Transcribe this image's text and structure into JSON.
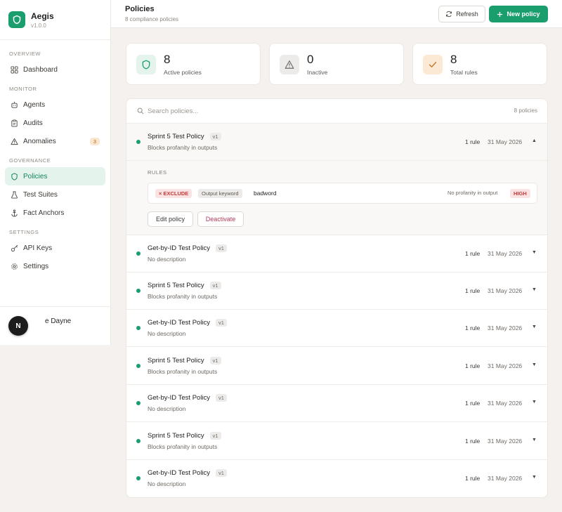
{
  "brand": {
    "name": "Aegis",
    "version": "v1.0.0"
  },
  "sidebar": {
    "sections": [
      {
        "label": "OVERVIEW",
        "items": [
          {
            "label": "Dashboard",
            "icon": "grid-icon"
          }
        ]
      },
      {
        "label": "MONITOR",
        "items": [
          {
            "label": "Agents",
            "icon": "robot-icon"
          },
          {
            "label": "Audits",
            "icon": "clipboard-icon"
          },
          {
            "label": "Anomalies",
            "icon": "warning-icon",
            "badge": "3"
          }
        ]
      },
      {
        "label": "GOVERNANCE",
        "items": [
          {
            "label": "Policies",
            "icon": "shield-icon",
            "active": true
          },
          {
            "label": "Test Suites",
            "icon": "flask-icon"
          },
          {
            "label": "Fact Anchors",
            "icon": "anchor-icon"
          }
        ]
      },
      {
        "label": "SETTINGS",
        "items": [
          {
            "label": "API Keys",
            "icon": "key-icon"
          },
          {
            "label": "Settings",
            "icon": "gear-icon"
          }
        ]
      }
    ],
    "user": {
      "initial": "N",
      "name": "e Dayne"
    }
  },
  "header": {
    "title": "Policies",
    "subtitle": "8 compliance policies",
    "refresh_label": "Refresh",
    "new_label": "New policy"
  },
  "stats": [
    {
      "value": "8",
      "label": "Active policies",
      "icon": "shield-icon",
      "bg": "#e4f4ec",
      "color": "#1a9e6e"
    },
    {
      "value": "0",
      "label": "Inactive",
      "icon": "warning-icon",
      "bg": "#ecebe9",
      "color": "#6f6a65"
    },
    {
      "value": "8",
      "label": "Total rules",
      "icon": "check-icon",
      "bg": "#fbe8d5",
      "color": "#c27a2c"
    }
  ],
  "search": {
    "placeholder": "Search policies...",
    "count": "8 policies"
  },
  "policies": [
    {
      "name": "Sprint 5 Test Policy",
      "version": "v1",
      "description": "Blocks profanity in outputs",
      "rules": "1 rule",
      "date": "31 May 2026",
      "chevron": "▲"
    },
    {
      "name": "Get-by-ID Test Policy",
      "version": "v1",
      "description": "No description",
      "rules": "1 rule",
      "date": "31 May 2026",
      "chevron": "▼"
    },
    {
      "name": "Sprint 5 Test Policy",
      "version": "v1",
      "description": "Blocks profanity in outputs",
      "rules": "1 rule",
      "date": "31 May 2026",
      "chevron": "▼"
    },
    {
      "name": "Get-by-ID Test Policy",
      "version": "v1",
      "description": "No description",
      "rules": "1 rule",
      "date": "31 May 2026",
      "chevron": "▼"
    },
    {
      "name": "Sprint 5 Test Policy",
      "version": "v1",
      "description": "Blocks profanity in outputs",
      "rules": "1 rule",
      "date": "31 May 2026",
      "chevron": "▼"
    },
    {
      "name": "Get-by-ID Test Policy",
      "version": "v1",
      "description": "No description",
      "rules": "1 rule",
      "date": "31 May 2026",
      "chevron": "▼"
    },
    {
      "name": "Sprint 5 Test Policy",
      "version": "v1",
      "description": "Blocks profanity in outputs",
      "rules": "1 rule",
      "date": "31 May 2026",
      "chevron": "▼"
    },
    {
      "name": "Get-by-ID Test Policy",
      "version": "v1",
      "description": "No description",
      "rules": "1 rule",
      "date": "31 May 2026",
      "chevron": "▼"
    }
  ],
  "expanded": {
    "rules_label": "RULES",
    "rule": {
      "action": "× EXCLUDE",
      "kind": "Output keyword",
      "value": "badword",
      "note": "No profanity in output",
      "severity": "HIGH"
    },
    "edit_label": "Edit policy",
    "deactivate_label": "Deactivate"
  },
  "colors": {
    "accent": "#1a9e6e",
    "danger": "#c23b3b"
  }
}
